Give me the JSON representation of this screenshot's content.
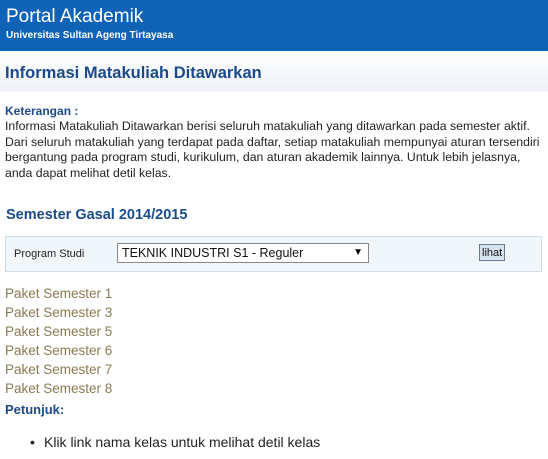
{
  "header": {
    "portal_title": "Portal Akademik",
    "university": "Universitas Sultan Ageng Tirtayasa"
  },
  "page": {
    "title": "Informasi Matakuliah Ditawarkan"
  },
  "keterangan": {
    "label": "Keterangan :",
    "text": "Informasi Matakuliah Ditawarkan berisi seluruh matakuliah yang ditawarkan pada semester aktif. Dari seluruh matakuliah yang terdapat pada daftar, setiap matakuliah mempunyai aturan tersendiri bergantung pada program studi, kurikulum, dan aturan akademik lainnya. Untuk lebih jelasnya, anda dapat melihat detil kelas."
  },
  "semester": {
    "title": "Semester Gasal 2014/2015"
  },
  "filter": {
    "program_label": "Program Studi",
    "selected_program": "TEKNIK INDUSTRI S1 - Reguler",
    "button_label": "lihat"
  },
  "paket": [
    "Paket Semester 1",
    "Paket Semester 3",
    "Paket Semester 5",
    "Paket Semester 6",
    "Paket Semester 7",
    "Paket Semester 8"
  ],
  "petunjuk": {
    "label": "Petunjuk:",
    "items": [
      "Klik link nama kelas untuk melihat detil kelas"
    ]
  },
  "colors": {
    "header_bg": "#0e63b6",
    "title_blue": "#1c4a8a",
    "link_olive": "#8a7a52"
  }
}
